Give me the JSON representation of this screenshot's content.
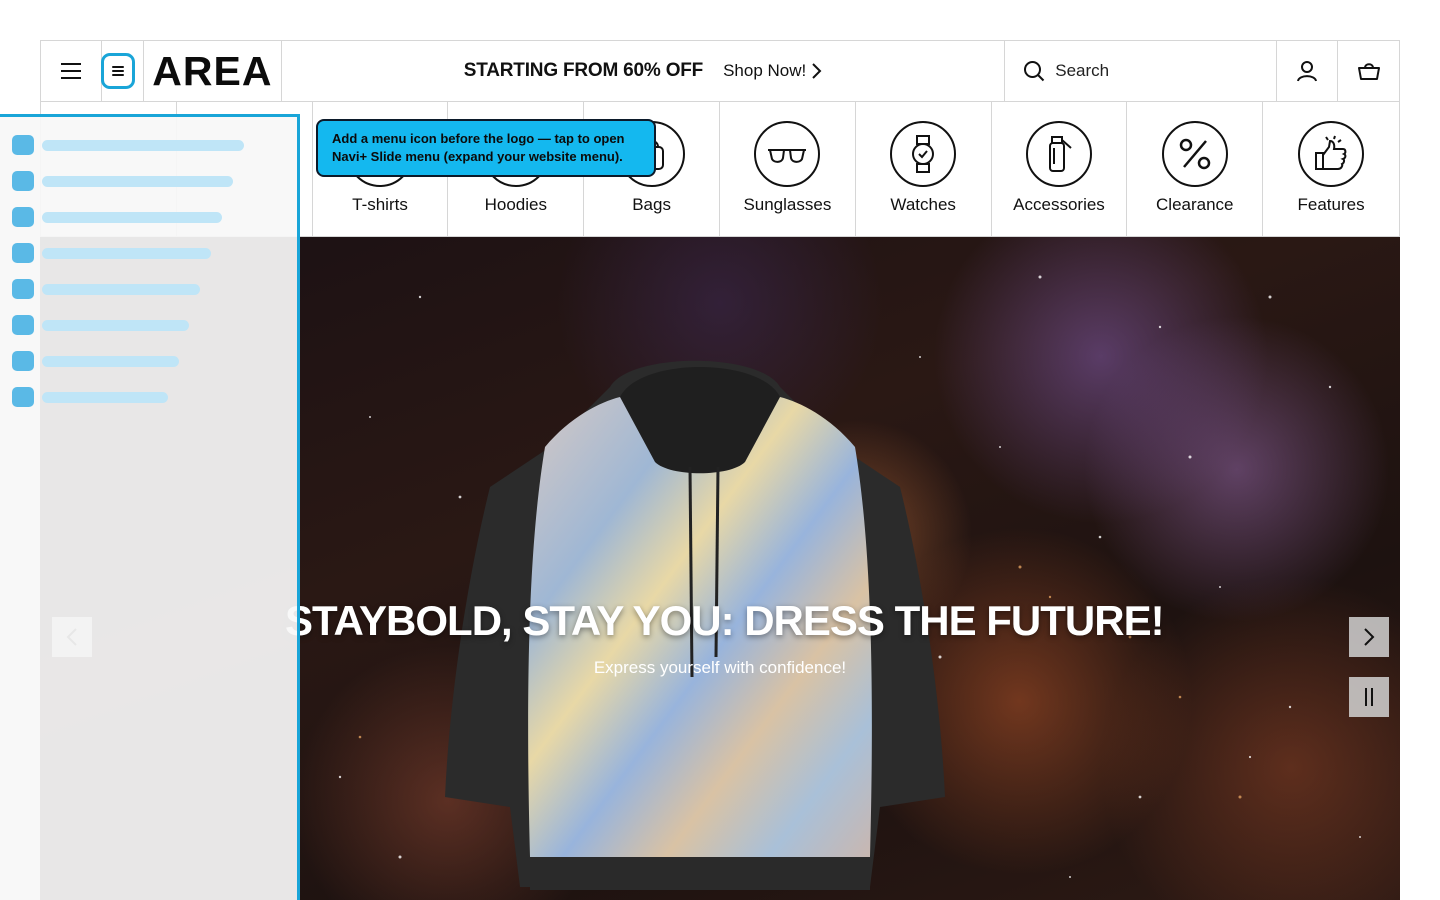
{
  "header": {
    "logo": "AREA",
    "promo_text": "STARTING FROM 60% OFF",
    "shop_now_label": "Shop Now!",
    "search_placeholder": "Search"
  },
  "categories": [
    {
      "label": "T-shirts",
      "icon": "tshirt-icon"
    },
    {
      "label": "Hoodies",
      "icon": "hoodie-icon"
    },
    {
      "label": "Bags",
      "icon": "bag-icon"
    },
    {
      "label": "Sunglasses",
      "icon": "sunglasses-icon"
    },
    {
      "label": "Watches",
      "icon": "watch-icon"
    },
    {
      "label": "Accessories",
      "icon": "bottle-icon"
    },
    {
      "label": "Clearance",
      "icon": "percent-icon"
    },
    {
      "label": "Features",
      "icon": "thumbs-up-icon"
    }
  ],
  "hero": {
    "title": "STAYBOLD, STAY YOU: DRESS THE FUTURE!",
    "subtitle": "Express yourself with confidence!"
  },
  "tooltip": {
    "text": "Add a menu icon before the logo — tap to open Navi+ Slide menu (expand your website menu)."
  },
  "colors": {
    "accent": "#19a5d8",
    "tooltip_bg": "#14b8ef",
    "menu_dot": "#5ab9e6",
    "menu_bar": "#bfe5f7"
  }
}
